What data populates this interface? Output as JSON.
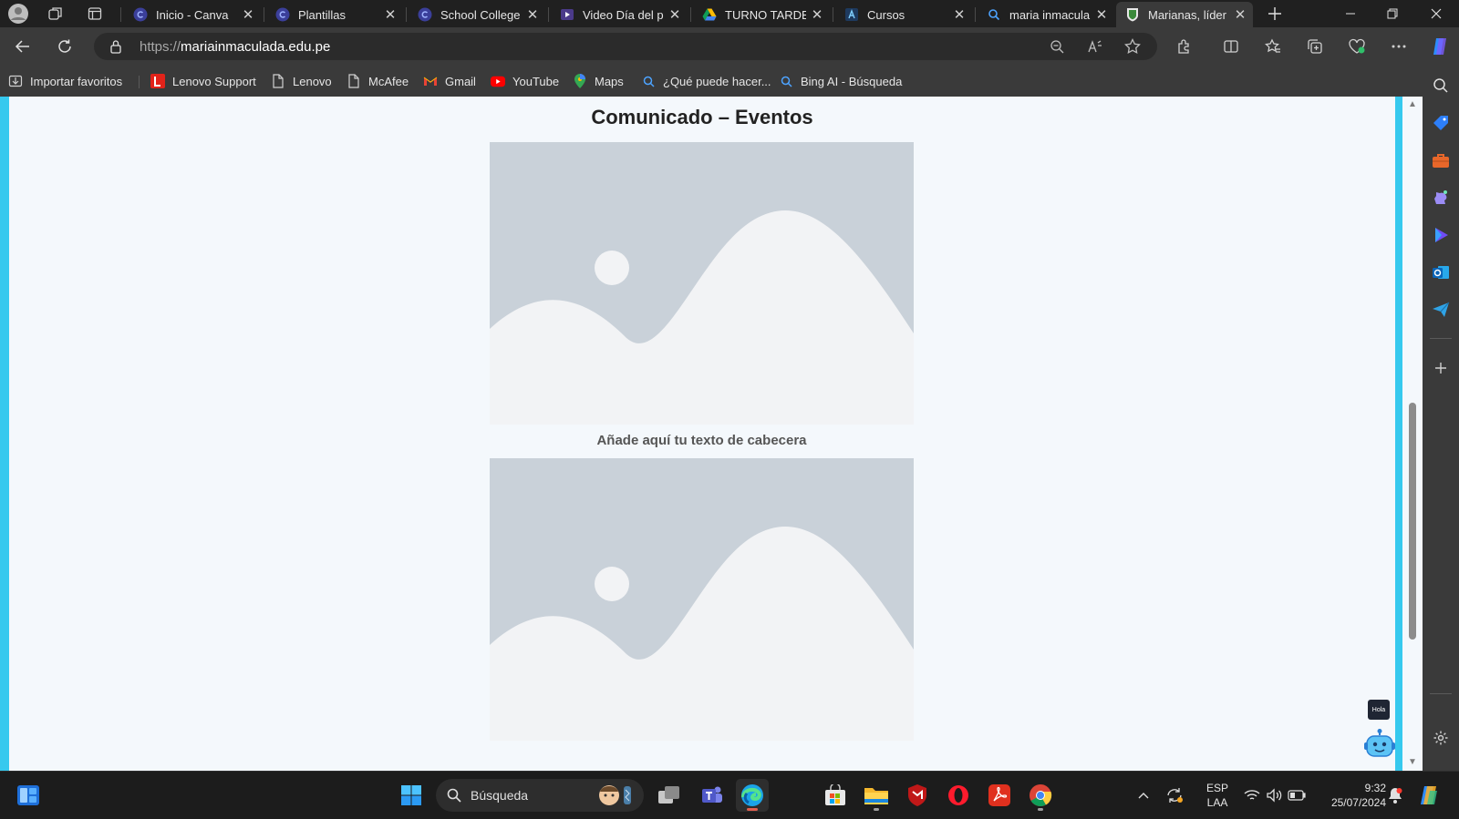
{
  "tabs": [
    {
      "title": "Inicio - Canva",
      "favicon": "canva-icon",
      "active": false
    },
    {
      "title": "Plantillas",
      "favicon": "canva-icon",
      "active": false
    },
    {
      "title": "School College",
      "favicon": "canva-icon",
      "active": false
    },
    {
      "title": "Video Día del p",
      "favicon": "video-icon",
      "active": false
    },
    {
      "title": "TURNO TARDE",
      "favicon": "google-drive-icon",
      "active": false
    },
    {
      "title": "Cursos",
      "favicon": "classroom-icon",
      "active": false
    },
    {
      "title": "maria inmacula",
      "favicon": "bing-search-icon",
      "active": false
    },
    {
      "title": "Marianas, líder",
      "favicon": "school-crest-icon",
      "active": true
    }
  ],
  "address_bar": {
    "protocol": "https://",
    "domain": "mariainmaculada.edu.pe"
  },
  "favorites": [
    {
      "label": "Importar favoritos",
      "icon": "import-favorites-icon"
    },
    {
      "label": "Lenovo Support",
      "icon": "lenovo-icon"
    },
    {
      "label": "Lenovo",
      "icon": "page-icon"
    },
    {
      "label": "McAfee",
      "icon": "page-icon"
    },
    {
      "label": "Gmail",
      "icon": "gmail-icon"
    },
    {
      "label": "YouTube",
      "icon": "youtube-icon"
    },
    {
      "label": "Maps",
      "icon": "maps-icon"
    },
    {
      "label": "¿Qué puede hacer...",
      "icon": "bing-search-icon"
    },
    {
      "label": "Bing AI - Búsqueda",
      "icon": "bing-search-icon"
    }
  ],
  "page": {
    "title": "Comunicado – Eventos",
    "caption": "Añade aquí tu texto de cabecera",
    "chatbot_bubble": "Hola",
    "images": [
      "image-placeholder",
      "image-placeholder"
    ]
  },
  "taskbar": {
    "search_label": "Búsqueda",
    "language": "ESP",
    "layout": "LAA",
    "time": "9:32",
    "date": "25/07/2024"
  },
  "colors": {
    "page_background": "#f4f8fc",
    "page_border": "#36c9ee",
    "placeholder_bg": "#c9d1d9",
    "placeholder_fg": "#f2f3f5",
    "browser_chrome": "#3a3a3a",
    "taskbar": "#1c1c1c"
  }
}
